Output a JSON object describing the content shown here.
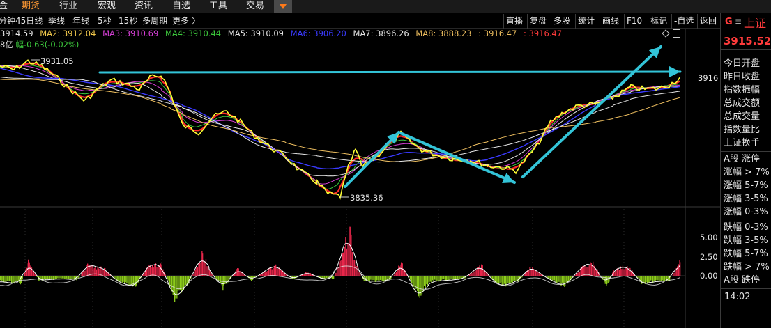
{
  "top_nav": {
    "items": [
      {
        "label": "金"
      },
      {
        "label": "期货",
        "active": true
      },
      {
        "label": "行业"
      },
      {
        "label": "宏观"
      },
      {
        "label": "资讯"
      },
      {
        "label": "自选"
      },
      {
        "label": "工具"
      },
      {
        "label": "交易"
      }
    ]
  },
  "toolbar": {
    "periods": [
      "分钟",
      "45日线",
      "季线",
      "年线",
      "5秒",
      "15秒",
      "多周期",
      "更多 〉"
    ],
    "buttons": [
      "直播",
      "复盘",
      "多股",
      "统计",
      "画线",
      "F10",
      "标记",
      "-自选",
      "返回"
    ]
  },
  "legend": {
    "ma1": "3914.59",
    "ma2": "MA2: 3912.04",
    "ma3": "MA3: 3910.69",
    "ma4": "MA4: 3910.44",
    "ma5": "MA5: 3910.09",
    "ma6": "MA6: 3906.20",
    "ma7": "MA7: 3896.26",
    "ma8": "MA8: 3888.23",
    "ext1": ": 3916.47",
    "ext2": ": 3916.47",
    "vol_prefix": "8亿",
    "change": "幅-0.63(-0.02%)"
  },
  "price_axis": {
    "current": "3916",
    "high_label": "3931.05",
    "low_label": "3835.36"
  },
  "indicator_axis": {
    "ticks": [
      "5.00",
      "2.50",
      "0.00"
    ]
  },
  "right_panel": {
    "symbol_badge": "G",
    "menu_icon": "≡",
    "name": "上证",
    "price": "3915.52",
    "fields": [
      "今日开盘",
      "昨日收盘",
      "指数振幅",
      "总成交额",
      "总成交量",
      "指数量比",
      "上证换手"
    ],
    "breadth_header_up": "A股 涨停",
    "breadth_up": [
      "涨幅 > 7%",
      "涨幅 5-7%",
      "涨幅 3-5%",
      "涨幅 0-3%"
    ],
    "breadth_down": [
      "跌幅 0-3%",
      "跌幅 3-5%",
      "跌幅 5-7%",
      "跌幅 > 7%"
    ],
    "breadth_footer_down": "A股 跌停",
    "time": "14:02"
  },
  "colors": {
    "ma1": "#e6e6e6",
    "ma2": "#f2c94c",
    "ma3": "#d63fd6",
    "ma4": "#3cc83c",
    "ma5": "#e6e6e6",
    "ma6": "#3a3aff",
    "ma7": "#e6e6e6",
    "ma8": "#f0c060",
    "ext1": "#f0c060",
    "ext2": "#ff3b3b",
    "price_line": "#ffff33",
    "candle_up": "#ff2a2a",
    "bar_up": "#e8264a",
    "bar_down": "#8ccc1a",
    "annotation_arrow": "#33c4d8",
    "accent_red": "#ff3b3b"
  }
}
